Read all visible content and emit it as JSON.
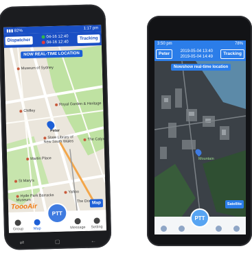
{
  "left_phone": {
    "status": {
      "time": "1:17 pm",
      "signal": "▮▮▮ 82%"
    },
    "dispatcher_label": "Dispatcher",
    "tracking_label": "Tracking",
    "times": [
      "04-16 12:40",
      "04-16 12:40"
    ],
    "banner": "NOW REAL-TIME LOCATION",
    "places": [
      "Museum of Sydney",
      "Chifley",
      "Royal Garden & Heritage",
      "Peter",
      "State Library of New South Wales",
      "The Calyx",
      "Martin Place",
      "St Mary's",
      "Hyde Park Barracks Museum",
      "Yahoo",
      "The Domain"
    ],
    "map_button": "Map",
    "logo": "ToooAir",
    "ptt": "PTT",
    "tabs": [
      "Group",
      "Map",
      "Message",
      "Setting"
    ],
    "accent": "#1a4fc4"
  },
  "right_phone": {
    "status": {
      "time": "3:50 pm",
      "battery": "78%"
    },
    "peter_label": "Peter",
    "tracking_label": "Tracking",
    "times": [
      "2019-05-04 13:40",
      "2019-05-04 14:49"
    ],
    "banner": "Nowshow real-time location",
    "place": "Mountain",
    "satellite": "Satellite",
    "ptt": "PTT"
  }
}
